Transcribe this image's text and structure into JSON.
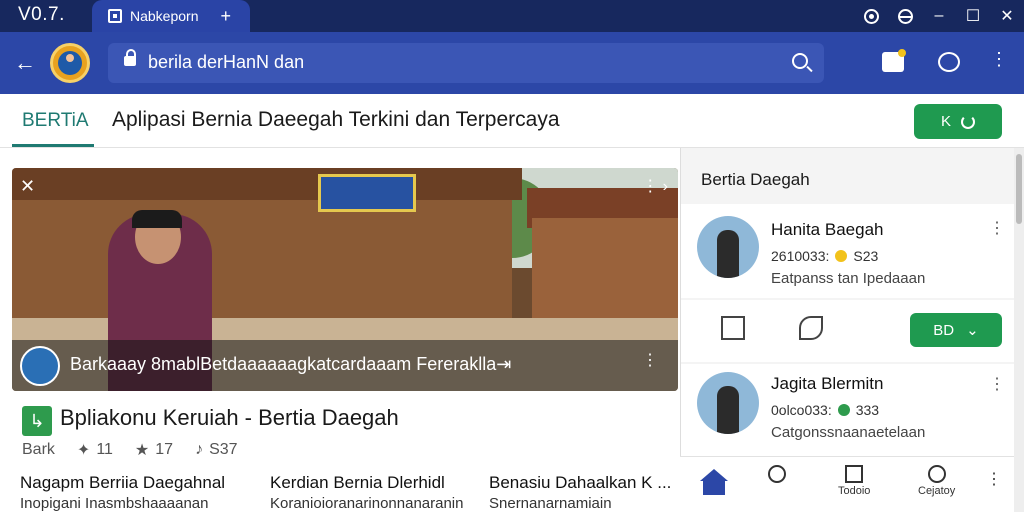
{
  "window": {
    "version": "V0.7.",
    "tab_label": "Nabkeporn",
    "tab_plus": "+",
    "controls": [
      "⦿",
      "⊖",
      "–",
      "☐",
      "✕"
    ]
  },
  "navbar": {
    "back": "←",
    "url_text": "berila derHanN dan",
    "menu": "⋮"
  },
  "header": {
    "brand": "BERTiA",
    "headline": "Aplipasi Bernia Daeegah  Terkini dan  Terpercaya",
    "button_label": "K"
  },
  "hero": {
    "caption": "Barkaaay 8mablBetdaaaaaagkatcardaaam Fereraklla⇥",
    "close": "✕",
    "dots": "⋮ ›"
  },
  "article": {
    "icon": "↳",
    "title": "Bpliakonu Keruiah - Bertia Daegah",
    "meta": [
      {
        "icon": "",
        "value": "Bark"
      },
      {
        "icon": "✦",
        "value": "11"
      },
      {
        "icon": "★",
        "value": "17"
      },
      {
        "icon": "♪",
        "value": "S37"
      }
    ]
  },
  "cards": [
    {
      "title": "Nagapm Berriia Daegahnal",
      "sub": "Inopigani Inasmbshaaaanan"
    },
    {
      "title": "Kerdian Bernia Dlerhidl",
      "sub": "Koranioioranarinonnanaranin"
    },
    {
      "title": "Benasiu Dahaalkan K ...",
      "sub": "Snernanarnamiain"
    }
  ],
  "rpanel": {
    "title": "Bertia Daegah",
    "items": [
      {
        "name": "Hanita Baegah",
        "stat": "2610033:",
        "stat2": "S23",
        "desc": "Eatpanss tan Ipedaaan",
        "badge": "#f2c21b"
      },
      {
        "name": "Jagita Blermitn",
        "stat": "0olco033:",
        "stat2": "333",
        "desc": "Catgonssnaanaetelaan",
        "badge": "#2e9b4d"
      }
    ],
    "more": "⋮",
    "bd_button": "BD",
    "bd_chevron": "⌄"
  },
  "bottomnav": {
    "items": [
      {
        "label": ""
      },
      {
        "label": ""
      },
      {
        "label": "Todoio"
      },
      {
        "label": "Cejatoy"
      }
    ],
    "more": "⋮"
  }
}
